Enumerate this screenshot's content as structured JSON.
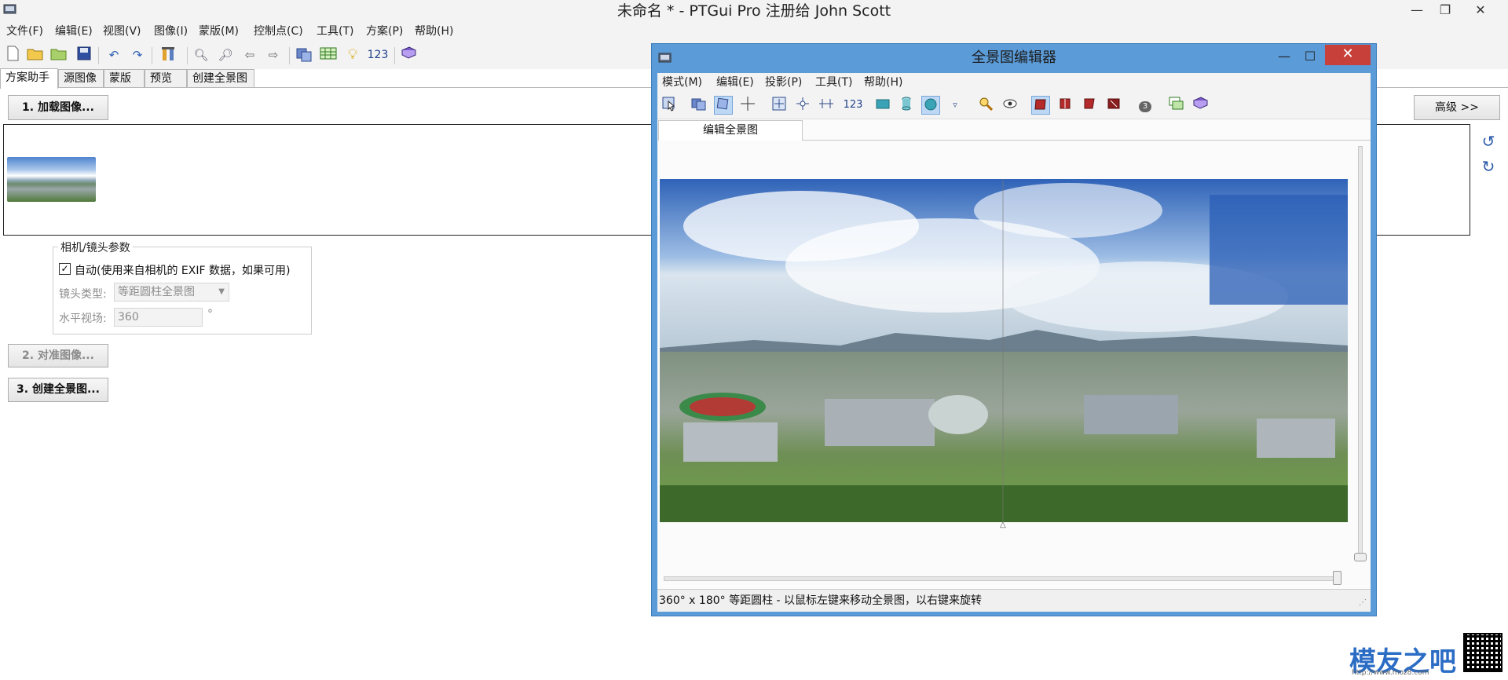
{
  "window": {
    "title": "未命名 * - PTGui Pro 注册给 John Scott",
    "controls": {
      "minimize": "—",
      "restore": "❐",
      "close": "✕"
    }
  },
  "menu": [
    "文件(F)",
    "编辑(E)",
    "视图(V)",
    "图像(I)",
    "蒙版(M)",
    "控制点(C)",
    "工具(T)",
    "方案(P)",
    "帮助(H)"
  ],
  "toolbar": {
    "counter_label": "123"
  },
  "tabs": [
    "方案助手",
    "源图像",
    "蒙版",
    "预览",
    "创建全景图"
  ],
  "assistant": {
    "load_button": "1. 加载图像...",
    "align_button": "2. 对准图像...",
    "create_button": "3. 创建全景图...",
    "advanced_button": "高级 >>"
  },
  "camera": {
    "group_label": "相机/镜头参数",
    "auto_label": "自动(使用来自相机的 EXIF 数据，如果可用)",
    "auto_checked": true,
    "lens_type_label": "镜头类型:",
    "lens_type_value": "等距圆柱全景图",
    "hfov_label": "水平视场:",
    "hfov_value": "360",
    "hfov_unit": "°"
  },
  "editor": {
    "title": "全景图编辑器",
    "close": "✕",
    "menu": [
      "模式(M)",
      "编辑(E)",
      "投影(P)",
      "工具(T)",
      "帮助(H)"
    ],
    "toolbar_number": "123",
    "badge_number": "3",
    "dropdown_arrow": "▿",
    "tab": "编辑全景图",
    "status": "360° x 180° 等距圆柱 - 以鼠标左键来移动全景图，以右键来旋转"
  },
  "watermark": {
    "text": "模友之吧",
    "sub": "http://www.moz8.com"
  },
  "colors": {
    "accent": "#5b9bd8",
    "close_red": "#c7403a",
    "link_blue": "#2a5aa8"
  }
}
